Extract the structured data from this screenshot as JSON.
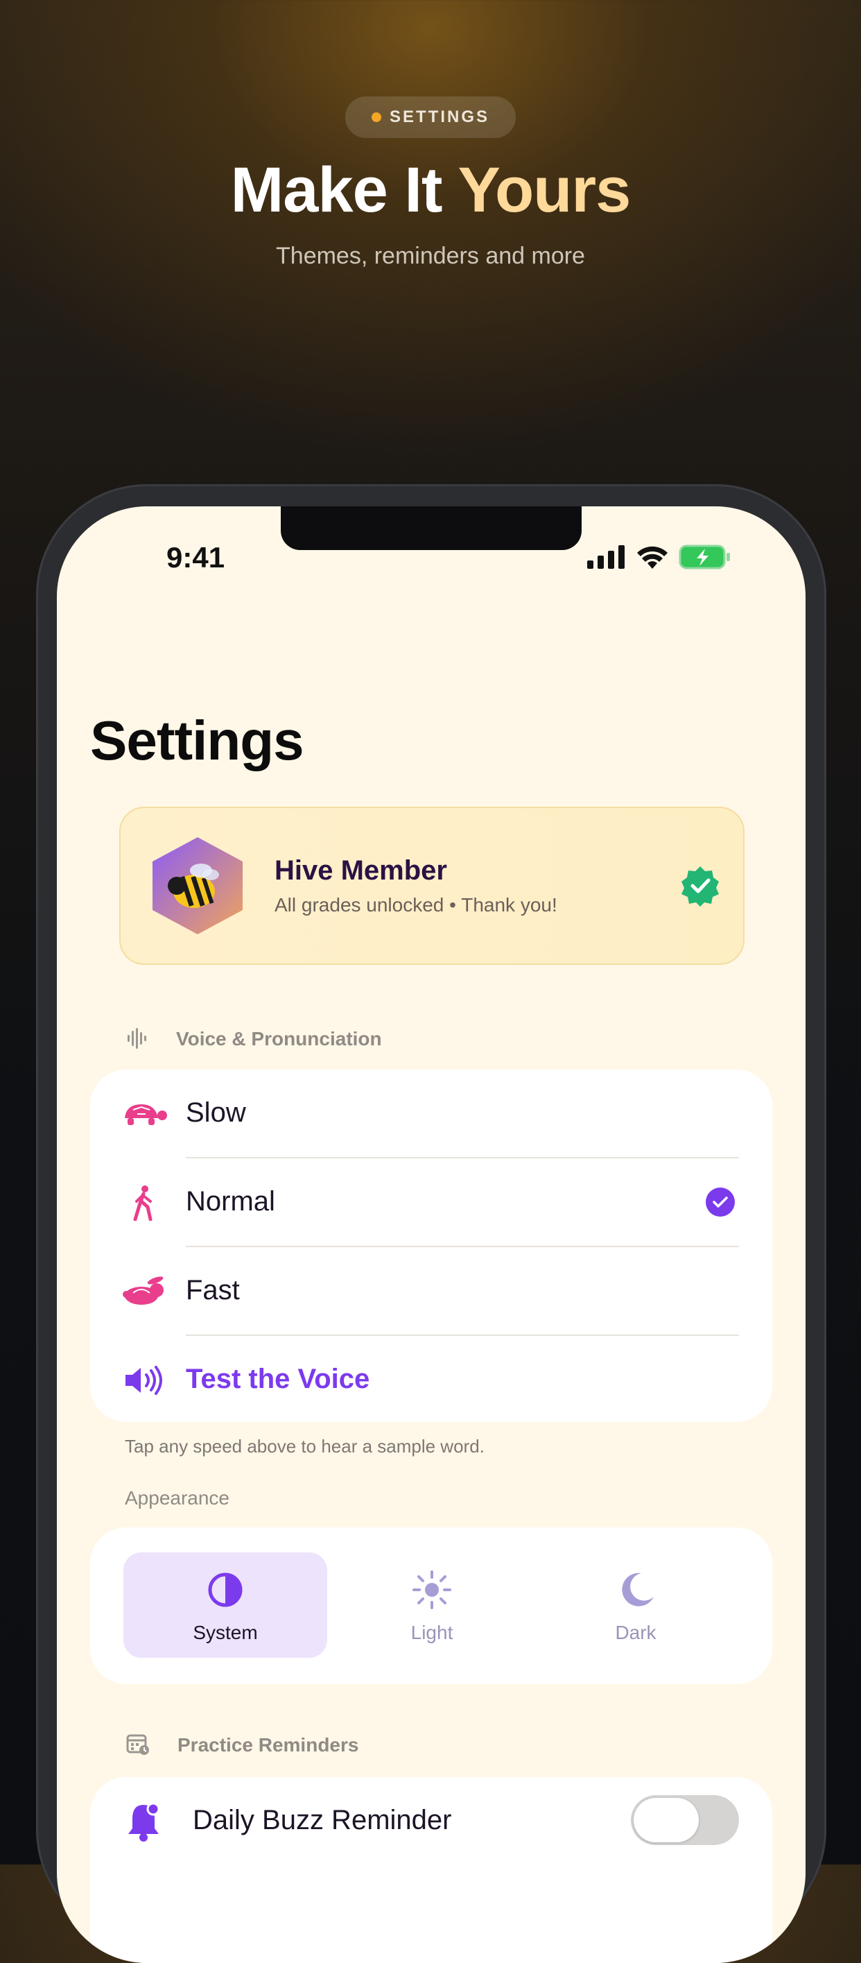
{
  "promo": {
    "pill_label": "SETTINGS",
    "headline_part1": "Make It ",
    "headline_accent": "Yours",
    "subhead": "Themes, reminders and more"
  },
  "status_bar": {
    "time": "9:41"
  },
  "page": {
    "title": "Settings"
  },
  "membership": {
    "name": "Hive Member",
    "subtitle": "All grades unlocked • Thank you!",
    "icon": "bee-emoji",
    "badge_icon": "verified-badge-icon"
  },
  "voice": {
    "section_label": "Voice & Pronunciation",
    "options": [
      {
        "label": "Slow",
        "icon": "turtle-icon",
        "selected": false
      },
      {
        "label": "Normal",
        "icon": "walking-person-icon",
        "selected": true
      },
      {
        "label": "Fast",
        "icon": "rabbit-icon",
        "selected": false
      }
    ],
    "test_label": "Test the Voice",
    "hint": "Tap any speed above to hear a sample word."
  },
  "appearance": {
    "section_label": "Appearance",
    "options": [
      {
        "label": "System",
        "icon": "half-circle-icon",
        "selected": true
      },
      {
        "label": "Light",
        "icon": "sun-icon",
        "selected": false
      },
      {
        "label": "Dark",
        "icon": "moon-icon",
        "selected": false
      }
    ]
  },
  "reminders": {
    "section_label": "Practice Reminders",
    "daily_label": "Daily Buzz Reminder",
    "daily_enabled": false
  },
  "colors": {
    "accent_purple": "#7c3aed",
    "accent_pink": "#e83e8c",
    "accent_gold": "#ffd99a",
    "screen_bg": "#fff8e8"
  }
}
